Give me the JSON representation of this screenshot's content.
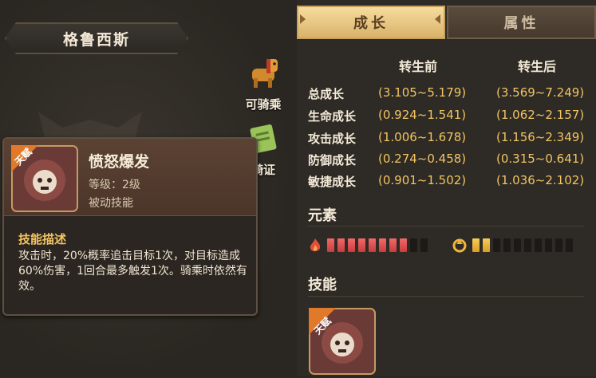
{
  "pet": {
    "name": "格鲁西斯",
    "actions": {
      "ride_label": "可骑乘",
      "license_label": "骑证"
    }
  },
  "tooltip": {
    "badge": "天赋",
    "name": "愤怒爆发",
    "level": "等级：2级",
    "type": "被动技能",
    "desc_title": "技能描述",
    "desc": "攻击时，20%概率追击目标1次，对目标造成60%伤害，1回合最多触发1次。骑乘时依然有效。"
  },
  "tabs": {
    "growth": "成长",
    "attributes": "属性",
    "active": "growth"
  },
  "growth": {
    "header_before": "转生前",
    "header_after": "转生后",
    "rows": [
      {
        "name": "总成长",
        "before": "(3.105~5.179)",
        "after": "(3.569~7.249)"
      },
      {
        "name": "生命成长",
        "before": "(0.924~1.541)",
        "after": "(1.062~2.157)"
      },
      {
        "name": "攻击成长",
        "before": "(1.006~1.678)",
        "after": "(1.156~2.349)"
      },
      {
        "name": "防御成长",
        "before": "(0.274~0.458)",
        "after": "(0.315~0.641)"
      },
      {
        "name": "敏捷成长",
        "before": "(0.901~1.502)",
        "after": "(1.036~2.102)"
      }
    ]
  },
  "elements": {
    "title": "元素",
    "fire": {
      "icon": "fire-icon",
      "filled": 8,
      "total": 10,
      "color": "#e05050"
    },
    "wind": {
      "icon": "wind-icon",
      "filled": 2,
      "total": 10,
      "color": "#f0b63a"
    }
  },
  "skills": {
    "title": "技能",
    "slot_badge": "天赋"
  }
}
